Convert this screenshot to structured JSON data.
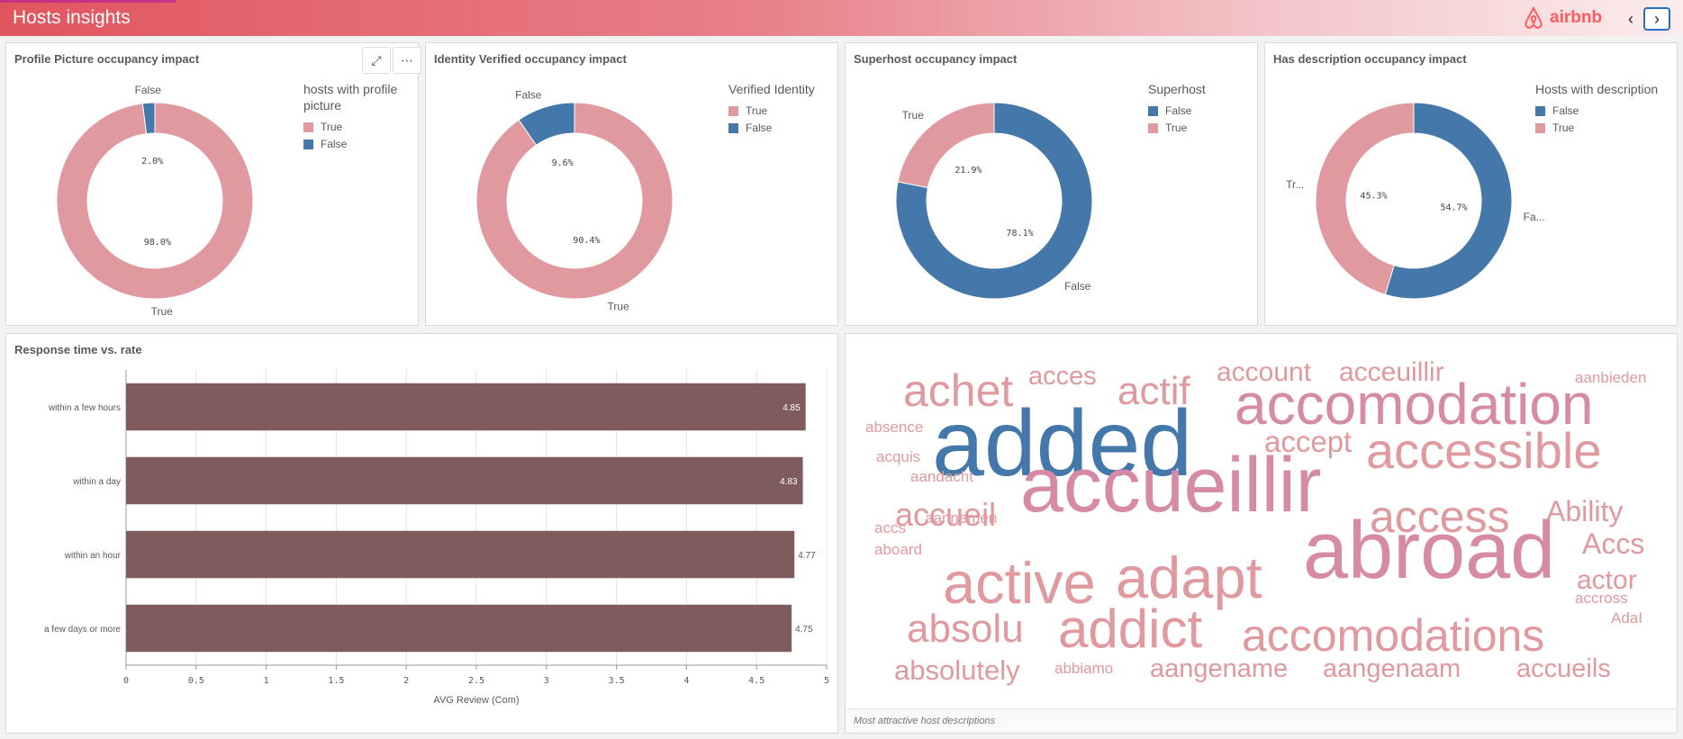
{
  "app": {
    "title": "Hosts insights",
    "brand": "airbnb",
    "prev_icon": "chevron-left-icon",
    "next_icon": "chevron-right-icon"
  },
  "colors": {
    "pink": "#e0999e",
    "blue": "#4477aa",
    "bar": "#7f5b5b",
    "header_start": "#e1555e"
  },
  "donuts": [
    {
      "title": "Profile Picture occupancy impact",
      "legend_title": "hosts with profile picture",
      "legend": [
        {
          "label": "True",
          "color": "#e0999e"
        },
        {
          "label": "False",
          "color": "#4477aa"
        }
      ],
      "slices": [
        {
          "label": "True",
          "value": 98.0,
          "pct_text": "98.0%",
          "color": "#e0999e"
        },
        {
          "label": "False",
          "value": 2.0,
          "pct_text": "2.0%",
          "color": "#4477aa"
        }
      ],
      "has_tools": true
    },
    {
      "title": "Identity Verified occupancy impact",
      "legend_title": "Verified Identity",
      "legend": [
        {
          "label": "True",
          "color": "#e0999e"
        },
        {
          "label": "False",
          "color": "#4477aa"
        }
      ],
      "slices": [
        {
          "label": "True",
          "value": 90.4,
          "pct_text": "90.4%",
          "color": "#e0999e"
        },
        {
          "label": "False",
          "value": 9.6,
          "pct_text": "9.6%",
          "color": "#4477aa"
        }
      ]
    },
    {
      "title": "Superhost occupancy impact",
      "legend_title": "Superhost",
      "legend": [
        {
          "label": "False",
          "color": "#4477aa"
        },
        {
          "label": "True",
          "color": "#e0999e"
        }
      ],
      "slices": [
        {
          "label": "False",
          "value": 78.1,
          "pct_text": "78.1%",
          "color": "#4477aa"
        },
        {
          "label": "True",
          "value": 21.9,
          "pct_text": "21.9%",
          "color": "#e0999e"
        }
      ]
    },
    {
      "title": "Has description occupancy impact",
      "legend_title": "Hosts with description",
      "legend": [
        {
          "label": "False",
          "color": "#4477aa"
        },
        {
          "label": "True",
          "color": "#e0999e"
        }
      ],
      "slices": [
        {
          "label": "Fa...",
          "value": 54.7,
          "pct_text": "54.7%",
          "color": "#4477aa"
        },
        {
          "label": "Tr...",
          "value": 45.3,
          "pct_text": "45.3%",
          "color": "#e0999e"
        }
      ]
    }
  ],
  "chart_data": [
    {
      "type": "pie",
      "title": "Profile Picture occupancy impact",
      "legend_title": "hosts with profile picture",
      "categories": [
        "True",
        "False"
      ],
      "values": [
        98.0,
        2.0
      ]
    },
    {
      "type": "pie",
      "title": "Identity Verified occupancy impact",
      "legend_title": "Verified Identity",
      "categories": [
        "True",
        "False"
      ],
      "values": [
        90.4,
        9.6
      ]
    },
    {
      "type": "pie",
      "title": "Superhost occupancy impact",
      "legend_title": "Superhost",
      "categories": [
        "False",
        "True"
      ],
      "values": [
        78.1,
        21.9
      ]
    },
    {
      "type": "pie",
      "title": "Has description occupancy impact",
      "legend_title": "Hosts with description",
      "categories": [
        "False",
        "True"
      ],
      "values": [
        54.7,
        45.3
      ]
    },
    {
      "type": "bar",
      "orientation": "horizontal",
      "title": "Response time vs. rate",
      "categories": [
        "within a few hours",
        "within a day",
        "within an hour",
        "a few days or more"
      ],
      "values": [
        4.85,
        4.83,
        4.77,
        4.75
      ],
      "xlabel": "AVG Review (Com)",
      "xlim": [
        0,
        5
      ],
      "ticks": [
        "0",
        "0.5",
        "1",
        "1.5",
        "2",
        "2.5",
        "3",
        "3.5",
        "4",
        "4.5",
        "5"
      ],
      "grid": true
    }
  ],
  "bar_panel": {
    "title": "Response time vs. rate",
    "xlabel": "AVG Review (Com)",
    "value_labels": [
      "4.85",
      "4.83",
      "4.77",
      "4.75"
    ]
  },
  "wordcloud": {
    "footnote": "Most attractive host descriptions",
    "words": [
      "achet",
      "acces",
      "actif",
      "account",
      "acceuillir",
      "aanbieden",
      "accomodation",
      "absence",
      "added",
      "accept",
      "acquis",
      "accessible",
      "aandacht",
      "accueillir",
      "access",
      "Ability",
      "accueil",
      "accs",
      "aannemen",
      "abroad",
      "Accs",
      "aboard",
      "active",
      "adapt",
      "actor",
      "accross",
      "absolu",
      "addict",
      "accomodations",
      "AdaI",
      "absolutely",
      "abbiamo",
      "aangename",
      "aangenaam",
      "accueils"
    ]
  }
}
